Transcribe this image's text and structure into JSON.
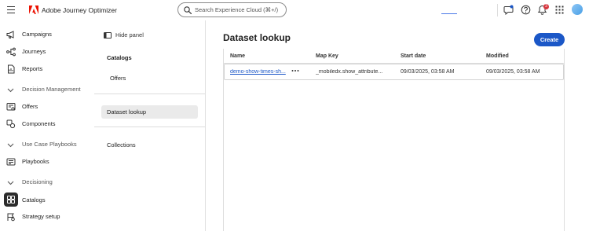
{
  "header": {
    "app_name": "Adobe Journey Optimizer",
    "search_placeholder": "Search Experience Cloud (⌘+/)",
    "notification_count": "3",
    "icons": [
      "menu-icon",
      "adobe-logo",
      "search-icon",
      "chat-icon",
      "help-icon",
      "bell-icon",
      "apps-grid-icon",
      "avatar"
    ]
  },
  "leftnav": {
    "items": [
      {
        "label": "Campaigns",
        "icon": "megaphone-icon"
      },
      {
        "label": "Journeys",
        "icon": "journey-icon"
      },
      {
        "label": "Reports",
        "icon": "report-icon"
      },
      {
        "label": "Decision Management",
        "icon": "chevron-down-icon",
        "section": true
      },
      {
        "label": "Offers",
        "icon": "offers-icon"
      },
      {
        "label": "Components",
        "icon": "components-icon"
      },
      {
        "label": "Use Case Playbooks",
        "icon": "chevron-down-icon",
        "section": true
      },
      {
        "label": "Playbooks",
        "icon": "playbooks-icon"
      },
      {
        "label": "Decisioning",
        "icon": "chevron-down-icon",
        "section": true
      },
      {
        "label": "Catalogs",
        "icon": "catalogs-icon",
        "active": true
      },
      {
        "label": "Strategy setup",
        "icon": "strategy-icon"
      }
    ]
  },
  "subpanel": {
    "hide_label": "Hide panel",
    "heading": "Catalogs",
    "items": [
      "Offers",
      "Dataset lookup",
      "Collections"
    ],
    "selected": "Dataset lookup"
  },
  "main": {
    "title": "Dataset lookup",
    "create_label": "Create",
    "columns": [
      "Name",
      "Map Key",
      "Start date",
      "Modified"
    ],
    "rows": [
      {
        "name": "demo-show-times-sh...",
        "map_key": "_mobiledx.show_attribute...",
        "start_date": "09/03/2025, 03:58 AM",
        "modified": "09/03/2025, 03:58 AM"
      }
    ]
  },
  "colors": {
    "accent": "#1b57c7",
    "badge": "#d7373f",
    "active_icon_bg": "#2c2c2c"
  }
}
